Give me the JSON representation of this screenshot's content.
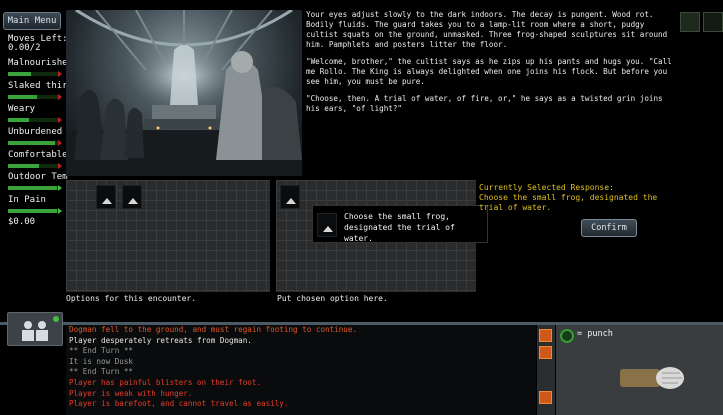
{
  "menu": {
    "label": "Main Menu"
  },
  "sidebar": {
    "moves_label": "Moves Left:",
    "moves_value": "0.00/2",
    "stats": [
      {
        "label": "Malnourished",
        "fill": 0.45,
        "marker": "red"
      },
      {
        "label": "Slaked thirst",
        "fill": 0.55,
        "marker": "red"
      },
      {
        "label": "Weary",
        "fill": 0.4,
        "marker": "red"
      },
      {
        "label": "Unburdened",
        "fill": 0.9,
        "marker": "red"
      },
      {
        "label": "Comfortable",
        "fill": 0.6,
        "marker": "red"
      },
      {
        "label": "Outdoor Tem",
        "fill": 0.95,
        "marker": "green"
      },
      {
        "label": "In Pain",
        "fill": 0.95,
        "marker": "green"
      }
    ],
    "money": "$0.00"
  },
  "story": {
    "paragraphs": [
      "Your eyes adjust slowly to the dark indoors. The decay is pungent. Wood rot. Bodily fluids. The guard takes you to a lamp-lit room where a short, pudgy cultist squats on the ground, unmasked. Three frog-shaped sculptures sit around him. Pamphlets and posters litter the floor.",
      "\"Welcome, brother,\" the cultist says as he zips up his pants and hugs you. \"Call me Rollo. The King is always delighted when one joins his flock. But before you see him, you must be pure.",
      "\"Choose, then. A trial of water, of fire, or,\" he says as a twisted grin joins his ears, \"of light?\""
    ]
  },
  "options": {
    "caption": "Options for this encounter.",
    "chosen_caption": "Put chosen option here."
  },
  "tooltip": {
    "line1": "Choose the small frog,",
    "line2": "designated the trial of water."
  },
  "response": {
    "title": "Currently Selected Response:",
    "text": "Choose the small frog, designated the trial of water.",
    "confirm_label": "Confirm"
  },
  "log": [
    {
      "text": "Dogman fell to the ground, and must regain footing to continue.",
      "color": "#e05828"
    },
    {
      "text": "Player desperately retreats from Dogman.",
      "color": "#e6e6e6"
    },
    {
      "text": "** End Turn **",
      "color": "#9a9a9a"
    },
    {
      "text": "It is now Dusk",
      "color": "#9a9a9a"
    },
    {
      "text": "** End Turn **",
      "color": "#9a9a9a"
    },
    {
      "text": "Player has painful blisters on their foot.",
      "color": "#e63c28"
    },
    {
      "text": "Player is weak with hunger.",
      "color": "#e63c28"
    },
    {
      "text": "Player is barefoot, and cannot travel as easily.",
      "color": "#e63c28"
    }
  ],
  "combat": {
    "action_label": "= punch"
  }
}
